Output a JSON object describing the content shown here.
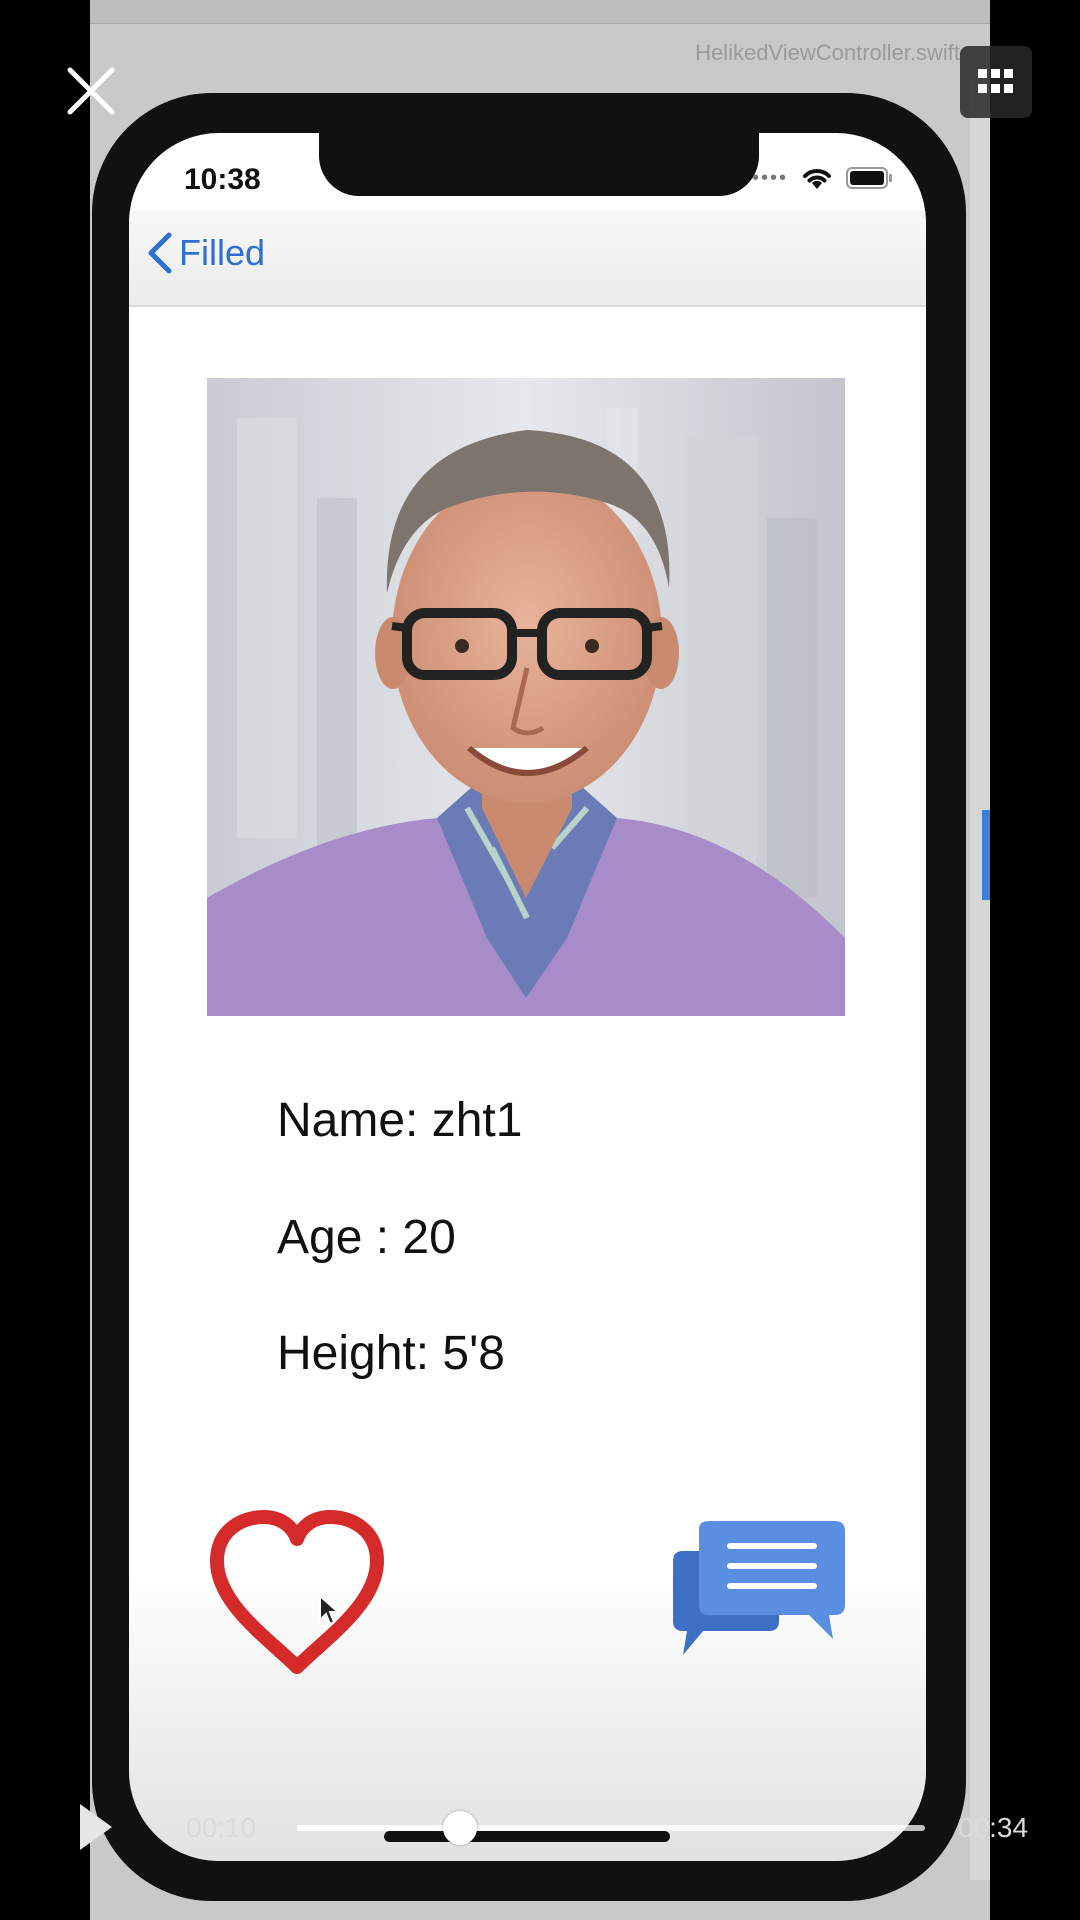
{
  "background": {
    "file_title": "HelikedViewController.swift"
  },
  "status_bar": {
    "time": "10:38"
  },
  "navbar": {
    "back_label": "Filled"
  },
  "profile": {
    "name_line": "Name: zht1",
    "age_line": "Age : 20",
    "height_line": "Height: 5'8"
  },
  "video_player": {
    "current_time": "00:10",
    "total_time": "00:34",
    "progress": 0.26
  },
  "icons": {
    "close": "close-icon",
    "grid": "grid-icon",
    "play": "play-icon",
    "back": "chevron-left-icon",
    "heart": "heart-icon",
    "chat": "chat-icon",
    "wifi": "wifi-icon",
    "battery": "battery-icon"
  },
  "colors": {
    "accent_blue": "#2f6fd0",
    "heart_red": "#d42a2a",
    "chat_blue": "#4f86dc"
  }
}
